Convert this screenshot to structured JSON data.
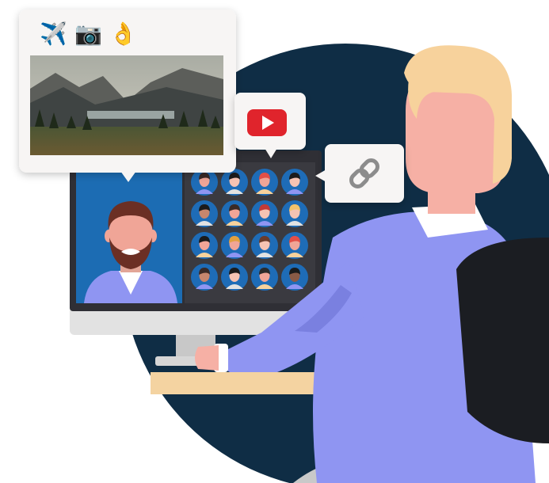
{
  "illustration": {
    "emoji_row": [
      "✈️",
      "📷",
      "👌"
    ],
    "icons": [
      "airplane-icon",
      "camera-icon",
      "ok-hand-icon",
      "youtube-icon",
      "link-icon"
    ],
    "grid": {
      "rows": 4,
      "columns": 4
    },
    "colors": {
      "background_circle": "#0f2d45",
      "monitor_bezel": "#2f2f35",
      "monitor_stand": "#dadada",
      "video_tile": "#1c6cb3",
      "grid_background": "#3a3a40",
      "avatar_circle": "#1e6cb7",
      "shirt": "#8f95f2",
      "hair": "#f7d29c",
      "skin": "#f6b0a5",
      "chair": "#1b1d22",
      "desk": "#f4d3a1",
      "youtube_red": "#e0242c",
      "bubble_bg": "#f7f5f4"
    }
  }
}
